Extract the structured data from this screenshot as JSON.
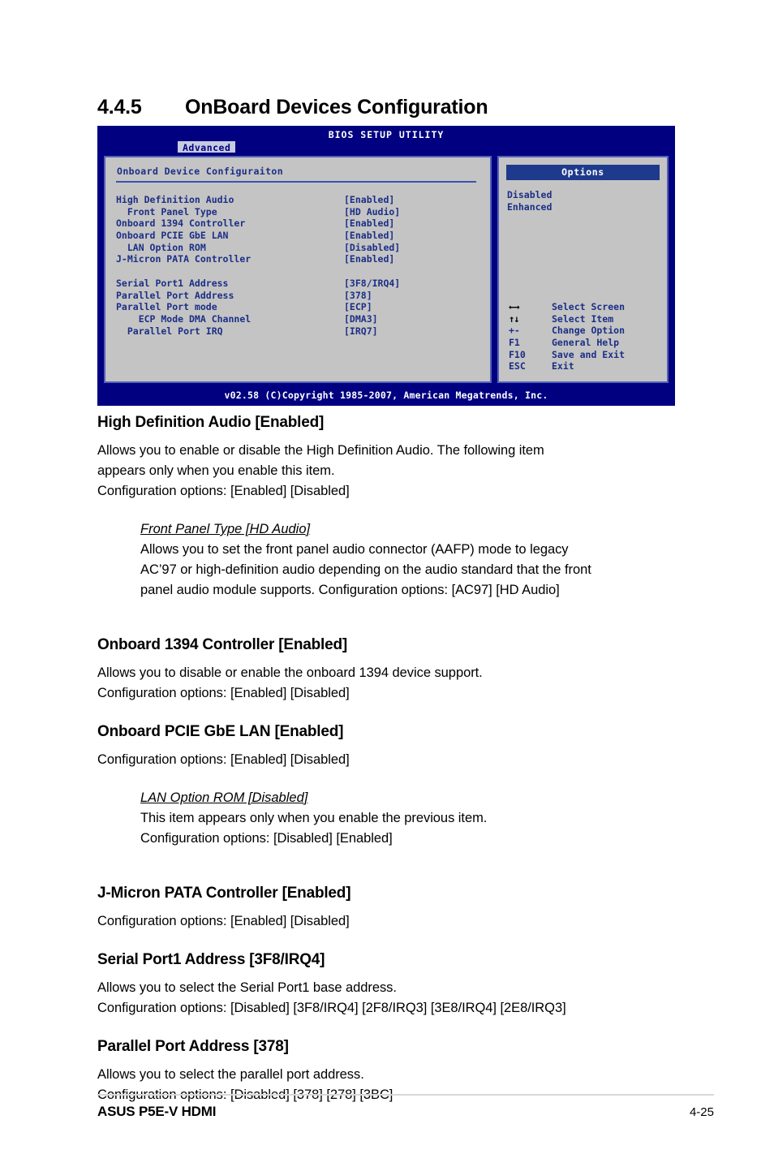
{
  "section": {
    "number": "4.4.5",
    "title": "OnBoard Devices Configuration"
  },
  "bios": {
    "title": "BIOS SETUP UTILITY",
    "tab": "Advanced",
    "panel_title": "Onboard Device Configuraiton",
    "settings": [
      {
        "label": "High Definition Audio",
        "value": "[Enabled]"
      },
      {
        "label": "  Front Panel Type",
        "value": "[HD Audio]"
      },
      {
        "label": "Onboard 1394 Controller",
        "value": "[Enabled]"
      },
      {
        "label": "Onboard PCIE GbE LAN",
        "value": "[Enabled]"
      },
      {
        "label": "  LAN Option ROM",
        "value": "[Disabled]"
      },
      {
        "label": "J-Micron PATA Controller",
        "value": "[Enabled]"
      },
      {
        "label": "",
        "value": ""
      },
      {
        "label": "Serial Port1 Address",
        "value": "[3F8/IRQ4]"
      },
      {
        "label": "Parallel Port Address",
        "value": "[378]"
      },
      {
        "label": "Parallel Port mode",
        "value": "[ECP]"
      },
      {
        "label": "    ECP Mode DMA Channel",
        "value": "[DMA3]"
      },
      {
        "label": "  Parallel Port IRQ",
        "value": "[IRQ7]"
      }
    ],
    "options_header": "Options",
    "options": [
      "Disabled",
      "Enhanced"
    ],
    "legend": [
      {
        "key": "←→",
        "glyph": true,
        "text": "Select Screen"
      },
      {
        "key": "↑↓",
        "glyph": true,
        "text": "Select Item"
      },
      {
        "key": "+-",
        "glyph": false,
        "text": "Change Option"
      },
      {
        "key": "F1",
        "glyph": false,
        "text": "General Help"
      },
      {
        "key": "F10",
        "glyph": false,
        "text": "Save and Exit"
      },
      {
        "key": "ESC",
        "glyph": false,
        "text": "Exit"
      }
    ],
    "footer": "v02.58 (C)Copyright 1985-2007, American Megatrends, Inc."
  },
  "prose": {
    "hda": {
      "heading": "High Definition Audio [Enabled]",
      "line1": "Allows you to enable or disable the High Definition Audio. The following item",
      "line2": "appears only when you enable this item.",
      "line3": "Configuration options: [Enabled] [Disabled]"
    },
    "front_panel": {
      "heading": "Front Panel Type [HD Audio]",
      "line1": "Allows you to set the front panel audio connector (AAFP) mode to legacy",
      "line2": "AC’97 or high-definition audio depending on the audio standard that the front",
      "line3": "panel audio module supports. Configuration options: [AC97] [HD Audio]"
    },
    "onboard1394": {
      "heading": "Onboard 1394 Controller [Enabled]",
      "line1": "Allows you to disable or enable the onboard 1394 device support.",
      "line2": "Configuration options: [Enabled] [Disabled]"
    },
    "pcie_lan": {
      "heading": "Onboard PCIE GbE LAN [Enabled]",
      "line1": "Configuration options: [Enabled] [Disabled]"
    },
    "lan_rom": {
      "heading": "LAN Option ROM [Disabled]",
      "line1": "This item appears only when you enable the previous item.",
      "line2": "Configuration options: [Disabled] [Enabled]"
    },
    "jmicron": {
      "heading": "J-Micron PATA Controller [Enabled]",
      "line1": "Configuration options: [Enabled] [Disabled]"
    },
    "serial": {
      "heading": "Serial Port1 Address [3F8/IRQ4]",
      "line1": "Allows you to select the Serial Port1 base address.",
      "line2": "Configuration options: [Disabled] [3F8/IRQ4] [2F8/IRQ3] [3E8/IRQ4] [2E8/IRQ3]"
    },
    "parallel": {
      "heading": "Parallel Port Address [378]",
      "line1": "Allows you to select the parallel port address.",
      "line2": "Configuration options: [Disabled] [378] [278] [3BC]"
    }
  },
  "page_footer": {
    "left": "ASUS P5E-V HDMI",
    "right": "4-25"
  }
}
